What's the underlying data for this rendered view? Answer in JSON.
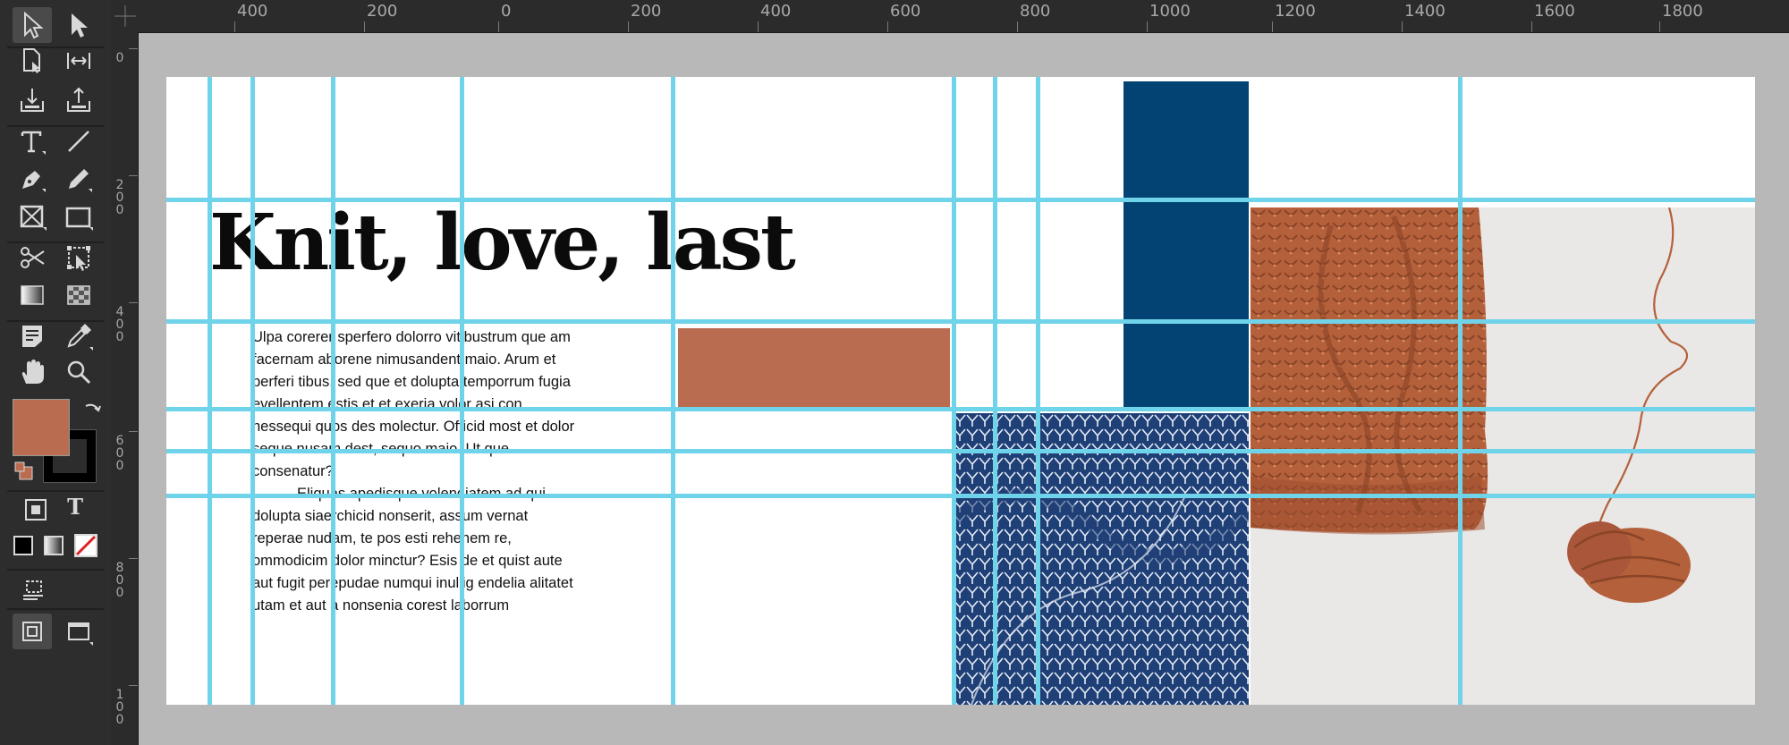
{
  "toolbar": {
    "tools": [
      {
        "name": "selection-tool-icon"
      },
      {
        "name": "direct-selection-tool-icon"
      },
      {
        "name": "page-tool-icon"
      },
      {
        "name": "gap-tool-icon"
      },
      {
        "name": "content-collector-icon"
      },
      {
        "name": "content-placer-icon"
      },
      {
        "name": "type-tool-icon"
      },
      {
        "name": "line-tool-icon"
      },
      {
        "name": "pen-tool-icon"
      },
      {
        "name": "pencil-tool-icon"
      },
      {
        "name": "rectangle-frame-tool-icon"
      },
      {
        "name": "rectangle-tool-icon"
      },
      {
        "name": "scissors-tool-icon"
      },
      {
        "name": "free-transform-tool-icon"
      },
      {
        "name": "gradient-swatch-tool-icon"
      },
      {
        "name": "gradient-feather-tool-icon"
      },
      {
        "name": "note-tool-icon"
      },
      {
        "name": "eyedropper-tool-icon"
      },
      {
        "name": "hand-tool-icon"
      },
      {
        "name": "zoom-tool-icon"
      }
    ],
    "fill_color": "#b96c4f",
    "stroke_color": "#000000",
    "type_toggle_label": "T"
  },
  "rulers": {
    "horizontal_labels": [
      "400",
      "200",
      "0",
      "200",
      "400",
      "600",
      "800",
      "1000",
      "1200",
      "1400",
      "1600",
      "1800"
    ],
    "vertical_labels": [
      "0",
      "200",
      "400",
      "600",
      "800",
      "100"
    ]
  },
  "page": {
    "headline": "Knit, love, last",
    "body_paragraph_1": "Ulpa corerer sperfero dolorro vitibustrum que am facernam aborene nimusandent maio. Arum et perferi tibus, sed que et dolupta temporrum fugia evellentem estis et et exeria volor asi con nessequi quos des molectur. Officid most et dolor seque nusam dest, sequo maio. Ut que consenatur?",
    "body_paragraph_2": "Eliquas apedisque volendiatem ad qui dolupta siaerchicid nonserit, assum vernat reperae nudam, te pos esti rehenem re, ommodicim dolor minctur? Esis de et quist aute aut fugit perepudae numqui inullig endelia alitatet utam et aut a nonsenia corest laborrum",
    "colors": {
      "terracotta": "#b96c4f",
      "navy": "#024373",
      "pattern_navy": "#1f3f77",
      "guide": "#6fd3ea",
      "photo_background": "#e9e8e6",
      "sweater": "#b4603b"
    }
  }
}
